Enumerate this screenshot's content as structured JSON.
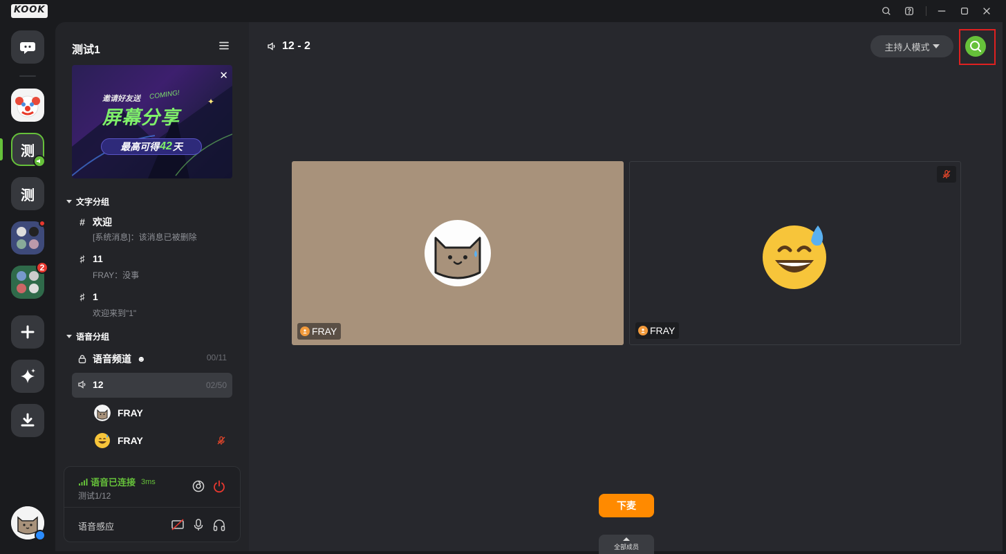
{
  "app": {
    "logo": "KOOK"
  },
  "titlebar": {
    "icons": [
      "search-icon",
      "help-icon",
      "minimize-icon",
      "maximize-icon",
      "close-icon"
    ]
  },
  "rail": {
    "servers": [
      {
        "name": "direct-messages",
        "icon": "dm-icon"
      },
      {
        "name": "clown-server",
        "icon": "clown-emoji"
      },
      {
        "name": "server-ce-1",
        "label": "测",
        "active": true
      },
      {
        "name": "server-ce-2",
        "label": "测"
      },
      {
        "name": "server-group-a",
        "dot": true
      },
      {
        "name": "server-group-b",
        "badge": "2"
      },
      {
        "name": "add-server",
        "icon": "plus-icon"
      },
      {
        "name": "discover",
        "icon": "sparkle-icon"
      },
      {
        "name": "download",
        "icon": "download-icon"
      }
    ]
  },
  "guild": {
    "name": "测试1",
    "banner": {
      "subtitle": "邀请好友送",
      "coming": "COMING!",
      "title": "屏幕分享",
      "pill_prefix": "最高可得",
      "pill_number": "42",
      "pill_suffix": "天"
    },
    "text_category": "文字分组",
    "text_channels": [
      {
        "name": "欢迎",
        "preview": "[系统消息]：该消息已被删除"
      },
      {
        "name": "11",
        "preview": "FRAY：没事"
      },
      {
        "name": "1",
        "preview": "欢迎来到\"1\""
      }
    ],
    "voice_category": "语音分组",
    "voice_channels": [
      {
        "name": "语音频道",
        "count": "00/11"
      },
      {
        "name": "12",
        "count": "02/50"
      }
    ],
    "voice_members": [
      {
        "name": "FRAY"
      },
      {
        "name": "FRAY"
      }
    ],
    "voice_status": {
      "connected": "语音已连接",
      "latency": "3ms",
      "channel_path": "测试1/12",
      "mode_label": "语音感应"
    }
  },
  "main": {
    "title": "12 - 2",
    "host_mode": "主持人模式",
    "tiles": [
      {
        "name": "FRAY"
      },
      {
        "name": "FRAY"
      }
    ],
    "leave_button": "下麦",
    "members_button": "全部成员"
  },
  "colors": {
    "accent_green": "#66c13a",
    "leave_orange": "#ff8a00",
    "highlight_red": "#e02020"
  }
}
